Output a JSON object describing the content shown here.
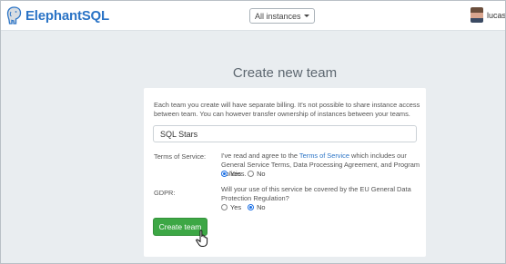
{
  "navbar": {
    "brand": "ElephantSQL",
    "instances_select": "All instances",
    "username": "lucasje"
  },
  "page": {
    "title": "Create new team"
  },
  "form": {
    "intro": "Each team you create will have separate billing. It's not possible to share instance access between team. You can however transfer ownership of instances between your teams.",
    "team_name_value": "SQL Stars",
    "terms": {
      "label": "Terms of Service:",
      "text_before": "I've read and agree to the ",
      "link": "Terms of Service",
      "text_after": " which includes our General Service Terms, Data Processing Agreement, and Program Policies.",
      "options": [
        "Yes",
        "No"
      ],
      "selected": "Yes"
    },
    "gdpr": {
      "label": "GDPR:",
      "text": "Will your use of this service be covered by the EU General Data Protection Regulation?",
      "options": [
        "Yes",
        "No"
      ],
      "selected": "No"
    },
    "submit_label": "Create team"
  },
  "colors": {
    "brand_blue": "#2b74c6",
    "button_green": "#3da745",
    "background": "#e9edf0"
  },
  "icons": [
    "elephant-logo-icon",
    "caret-down-icon",
    "pointer-hand-cursor-icon"
  ]
}
